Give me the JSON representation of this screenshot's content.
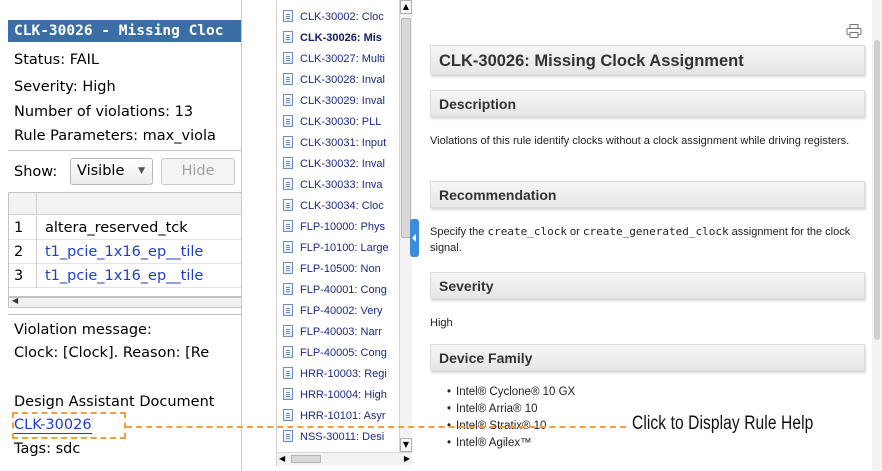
{
  "left_panel": {
    "rule_title": "CLK-30026 - Missing Cloc",
    "info": [
      "Status: FAIL",
      "Severity: High",
      "Number of violations: 13",
      "Rule Parameters: max_viola"
    ],
    "show_label": "Show:",
    "visible_select": "Visible",
    "hide_button": "Hide",
    "table_rows": [
      {
        "num": "1",
        "name": "altera_reserved_tck",
        "link": false
      },
      {
        "num": "2",
        "name": "t1_pcie_1x16_ep__tile",
        "link": true
      },
      {
        "num": "3",
        "name": "t1_pcie_1x16_ep__tile",
        "link": true
      }
    ],
    "violation_label": "Violation message:",
    "violation_text": "Clock: [Clock]. Reason: [Re",
    "doc_label": "Design Assistant Document",
    "rule_link": "CLK-30026",
    "tags": "Tags: sdc"
  },
  "tree_items": [
    "CLK-30002: Cloc",
    "CLK-30026: Mis",
    "CLK-30027: Multi",
    "CLK-30028: Inval",
    "CLK-30029: Inval",
    "CLK-30030: PLL",
    "CLK-30031: Input",
    "CLK-30032: Inval",
    "CLK-30033: Inva",
    "CLK-30034: Cloc",
    "FLP-10000: Phys",
    "FLP-10100: Large",
    "FLP-10500: Non",
    "FLP-40001: Cong",
    "FLP-40002: Very",
    "FLP-40003: Narr",
    "FLP-40005: Cong",
    "HRR-10003: Regi",
    "HRR-10004: High",
    "HRR-10101: Asyr",
    "NSS-30011: Desi"
  ],
  "tree_selected_index": 1,
  "help": {
    "title": "CLK-30026: Missing Clock Assignment",
    "description_heading": "Description",
    "description_text": "Violations of this rule identify clocks without a clock assignment while driving registers.",
    "recommendation_heading": "Recommendation",
    "rec_prefix": "Specify the ",
    "rec_code1": "create_clock",
    "rec_mid": " or ",
    "rec_code2": "create_generated_clock",
    "rec_suffix": " assignment for the clock signal.",
    "severity_heading": "Severity",
    "severity_value": "High",
    "device_family_heading": "Device Family",
    "device_families": [
      "Intel® Cyclone® 10 GX",
      "Intel® Arria® 10",
      "Intel® Stratix® 10",
      "Intel® Agilex™"
    ]
  },
  "callout": "Click to Display Rule Help",
  "colors": {
    "callout": "#f0a040",
    "title_bar": "#3a6ea5",
    "link": "#1a3fd0",
    "handle": "#3b8ed8"
  }
}
